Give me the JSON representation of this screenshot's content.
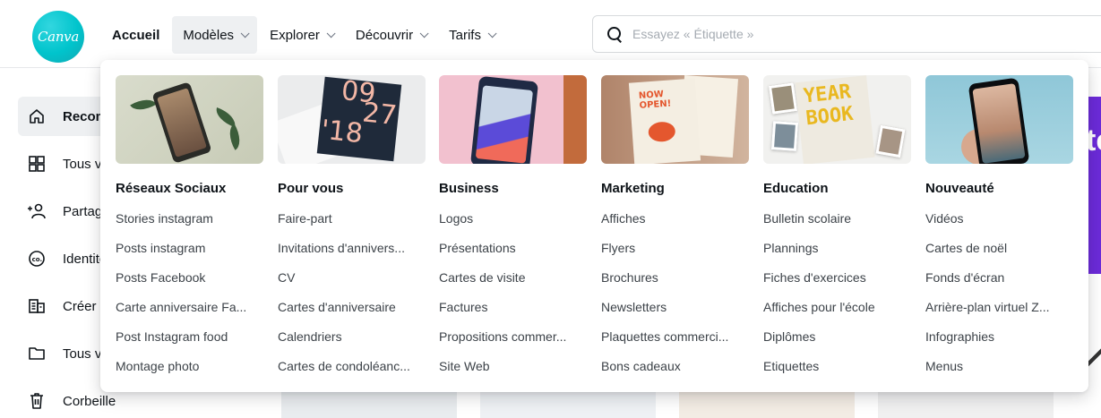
{
  "app": {
    "logo_text": "Canva",
    "brand_color": "#00c4cc"
  },
  "nav": {
    "items": [
      {
        "label": "Accueil",
        "active": true,
        "has_chevron": false
      },
      {
        "label": "Modèles",
        "active": false,
        "has_chevron": true,
        "open": true
      },
      {
        "label": "Explorer",
        "active": false,
        "has_chevron": true
      },
      {
        "label": "Découvrir",
        "active": false,
        "has_chevron": true
      },
      {
        "label": "Tarifs",
        "active": false,
        "has_chevron": true
      }
    ]
  },
  "search": {
    "icon": "search-icon",
    "placeholder": "Essayez « Étiquette »",
    "value": ""
  },
  "sidebar": {
    "items": [
      {
        "label": "Recommandé",
        "icon": "home-icon",
        "active": true
      },
      {
        "label": "Tous vos designs",
        "icon": "grid-icon",
        "active": false
      },
      {
        "label": "Partagé avec vous",
        "icon": "people-icon",
        "active": false
      },
      {
        "label": "Identité visuelle",
        "icon": "brand-kit-icon",
        "active": false
      },
      {
        "label": "Créer une équipe",
        "icon": "team-icon",
        "active": false
      },
      {
        "label": "Tous vos dossiers",
        "icon": "folder-icon",
        "active": false
      },
      {
        "label": "Corbeille",
        "icon": "trash-icon",
        "active": false
      }
    ]
  },
  "background": {
    "banner_text": "te",
    "banner_color": "#6c2bd9"
  },
  "dropdown": {
    "columns": [
      {
        "title": "Réseaux Sociaux",
        "image": "social-media-thumbnail",
        "items": [
          "Stories instagram",
          "Posts instagram",
          "Posts Facebook",
          "Carte anniversaire Fa...",
          "Post Instagram food",
          "Montage photo"
        ]
      },
      {
        "title": "Pour vous",
        "image": "for-you-thumbnail",
        "image_text": {
          "top": "09",
          "right": "27",
          "bottom": "'18"
        },
        "items": [
          "Faire-part",
          "Invitations d'annivers...",
          "CV",
          "Cartes d'anniversaire",
          "Calendriers",
          "Cartes de condoléanc..."
        ]
      },
      {
        "title": "Business",
        "image": "business-thumbnail",
        "items": [
          "Logos",
          "Présentations",
          "Cartes de visite",
          "Factures",
          "Propositions commer...",
          "Site Web"
        ]
      },
      {
        "title": "Marketing",
        "image": "marketing-thumbnail",
        "image_text": "NOW OPEN!",
        "items": [
          "Affiches",
          "Flyers",
          "Brochures",
          "Newsletters",
          "Plaquettes commerci...",
          "Bons cadeaux"
        ]
      },
      {
        "title": "Education",
        "image": "education-thumbnail",
        "image_text": "YEAR BOOK",
        "items": [
          "Bulletin scolaire",
          "Plannings",
          "Fiches d'exercices",
          "Affiches pour l'école",
          "Diplômes",
          "Etiquettes"
        ]
      },
      {
        "title": "Nouveauté",
        "image": "new-thumbnail",
        "items": [
          "Vidéos",
          "Cartes de noël",
          "Fonds d'écran",
          "Arrière-plan virtuel Z...",
          "Infographies",
          "Menus"
        ]
      }
    ]
  }
}
